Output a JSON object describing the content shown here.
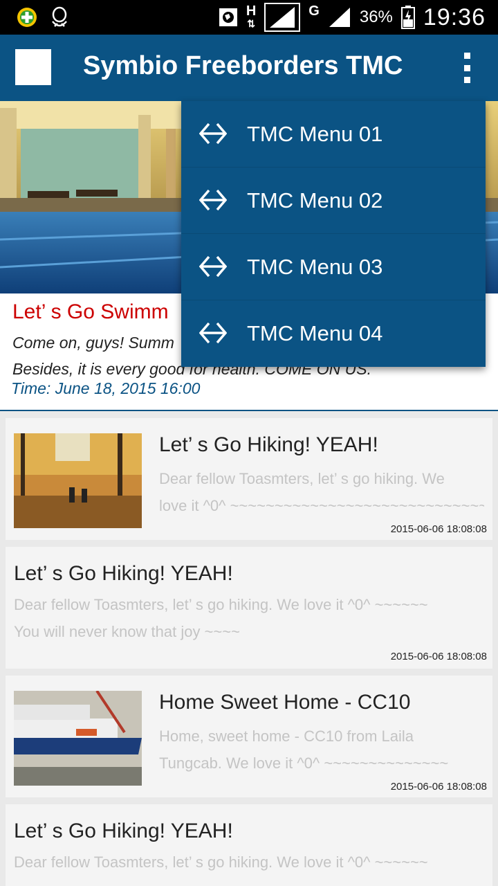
{
  "status_bar": {
    "left_icons": [
      "add-app-icon",
      "qq-penguin-icon"
    ],
    "right_icons": [
      "globe-icon",
      "h-data-icon",
      "signal-icon",
      "g-data-icon",
      "signal-icon",
      "battery-icon"
    ],
    "h_label": "H",
    "g_label": "G",
    "battery": "36%",
    "time": "19:36"
  },
  "app_bar": {
    "title": "Symbio Freeborders TMC",
    "bg_color": "#0b5384",
    "overflow_icon": "more-vert-icon"
  },
  "featured": {
    "title": "Let’ s Go Swimm",
    "desc_line1": "Come on, guys! Summ",
    "desc_line2": "Besides, it is every good for health. COME ON US.",
    "time": "Time: June 18, 2015 16:00",
    "title_color": "#cc0000"
  },
  "menu": {
    "items": [
      {
        "label": "TMC Menu 01",
        "icon": "left-right-arrow-icon"
      },
      {
        "label": "TMC Menu 02",
        "icon": "left-right-arrow-icon"
      },
      {
        "label": "TMC Menu 03",
        "icon": "left-right-arrow-icon"
      },
      {
        "label": "TMC Menu 04",
        "icon": "left-right-arrow-icon"
      }
    ]
  },
  "posts": [
    {
      "title": "Let’ s Go Hiking! YEAH!",
      "desc_line1": "Dear fellow Toasmters, let’ s go hiking. We",
      "desc_line2": "love it ^0^ ~~~~~~~~~~~~~~~~~~~~~~~~~~~~~",
      "date": "2015-06-06 18:08:08"
    },
    {
      "title": "Let’ s Go Hiking! YEAH!",
      "desc_line1": "Dear fellow Toasmters, let’ s go hiking. We love it ^0^ ~~~~~~",
      "desc_line2": "You will never know that joy ~~~~",
      "date": "2015-06-06 18:08:08"
    },
    {
      "title": "Home Sweet Home - CC10",
      "desc_line1": "Home, sweet home - CC10 from Laila",
      "desc_line2": "Tungcab. We love it ^0^ ~~~~~~~~~~~~~~",
      "date": "2015-06-06 18:08:08"
    },
    {
      "title": "Let’ s Go Hiking! YEAH!",
      "desc_line1": "Dear fellow Toasmters, let’ s go hiking. We love it ^0^ ~~~~~~"
    }
  ]
}
